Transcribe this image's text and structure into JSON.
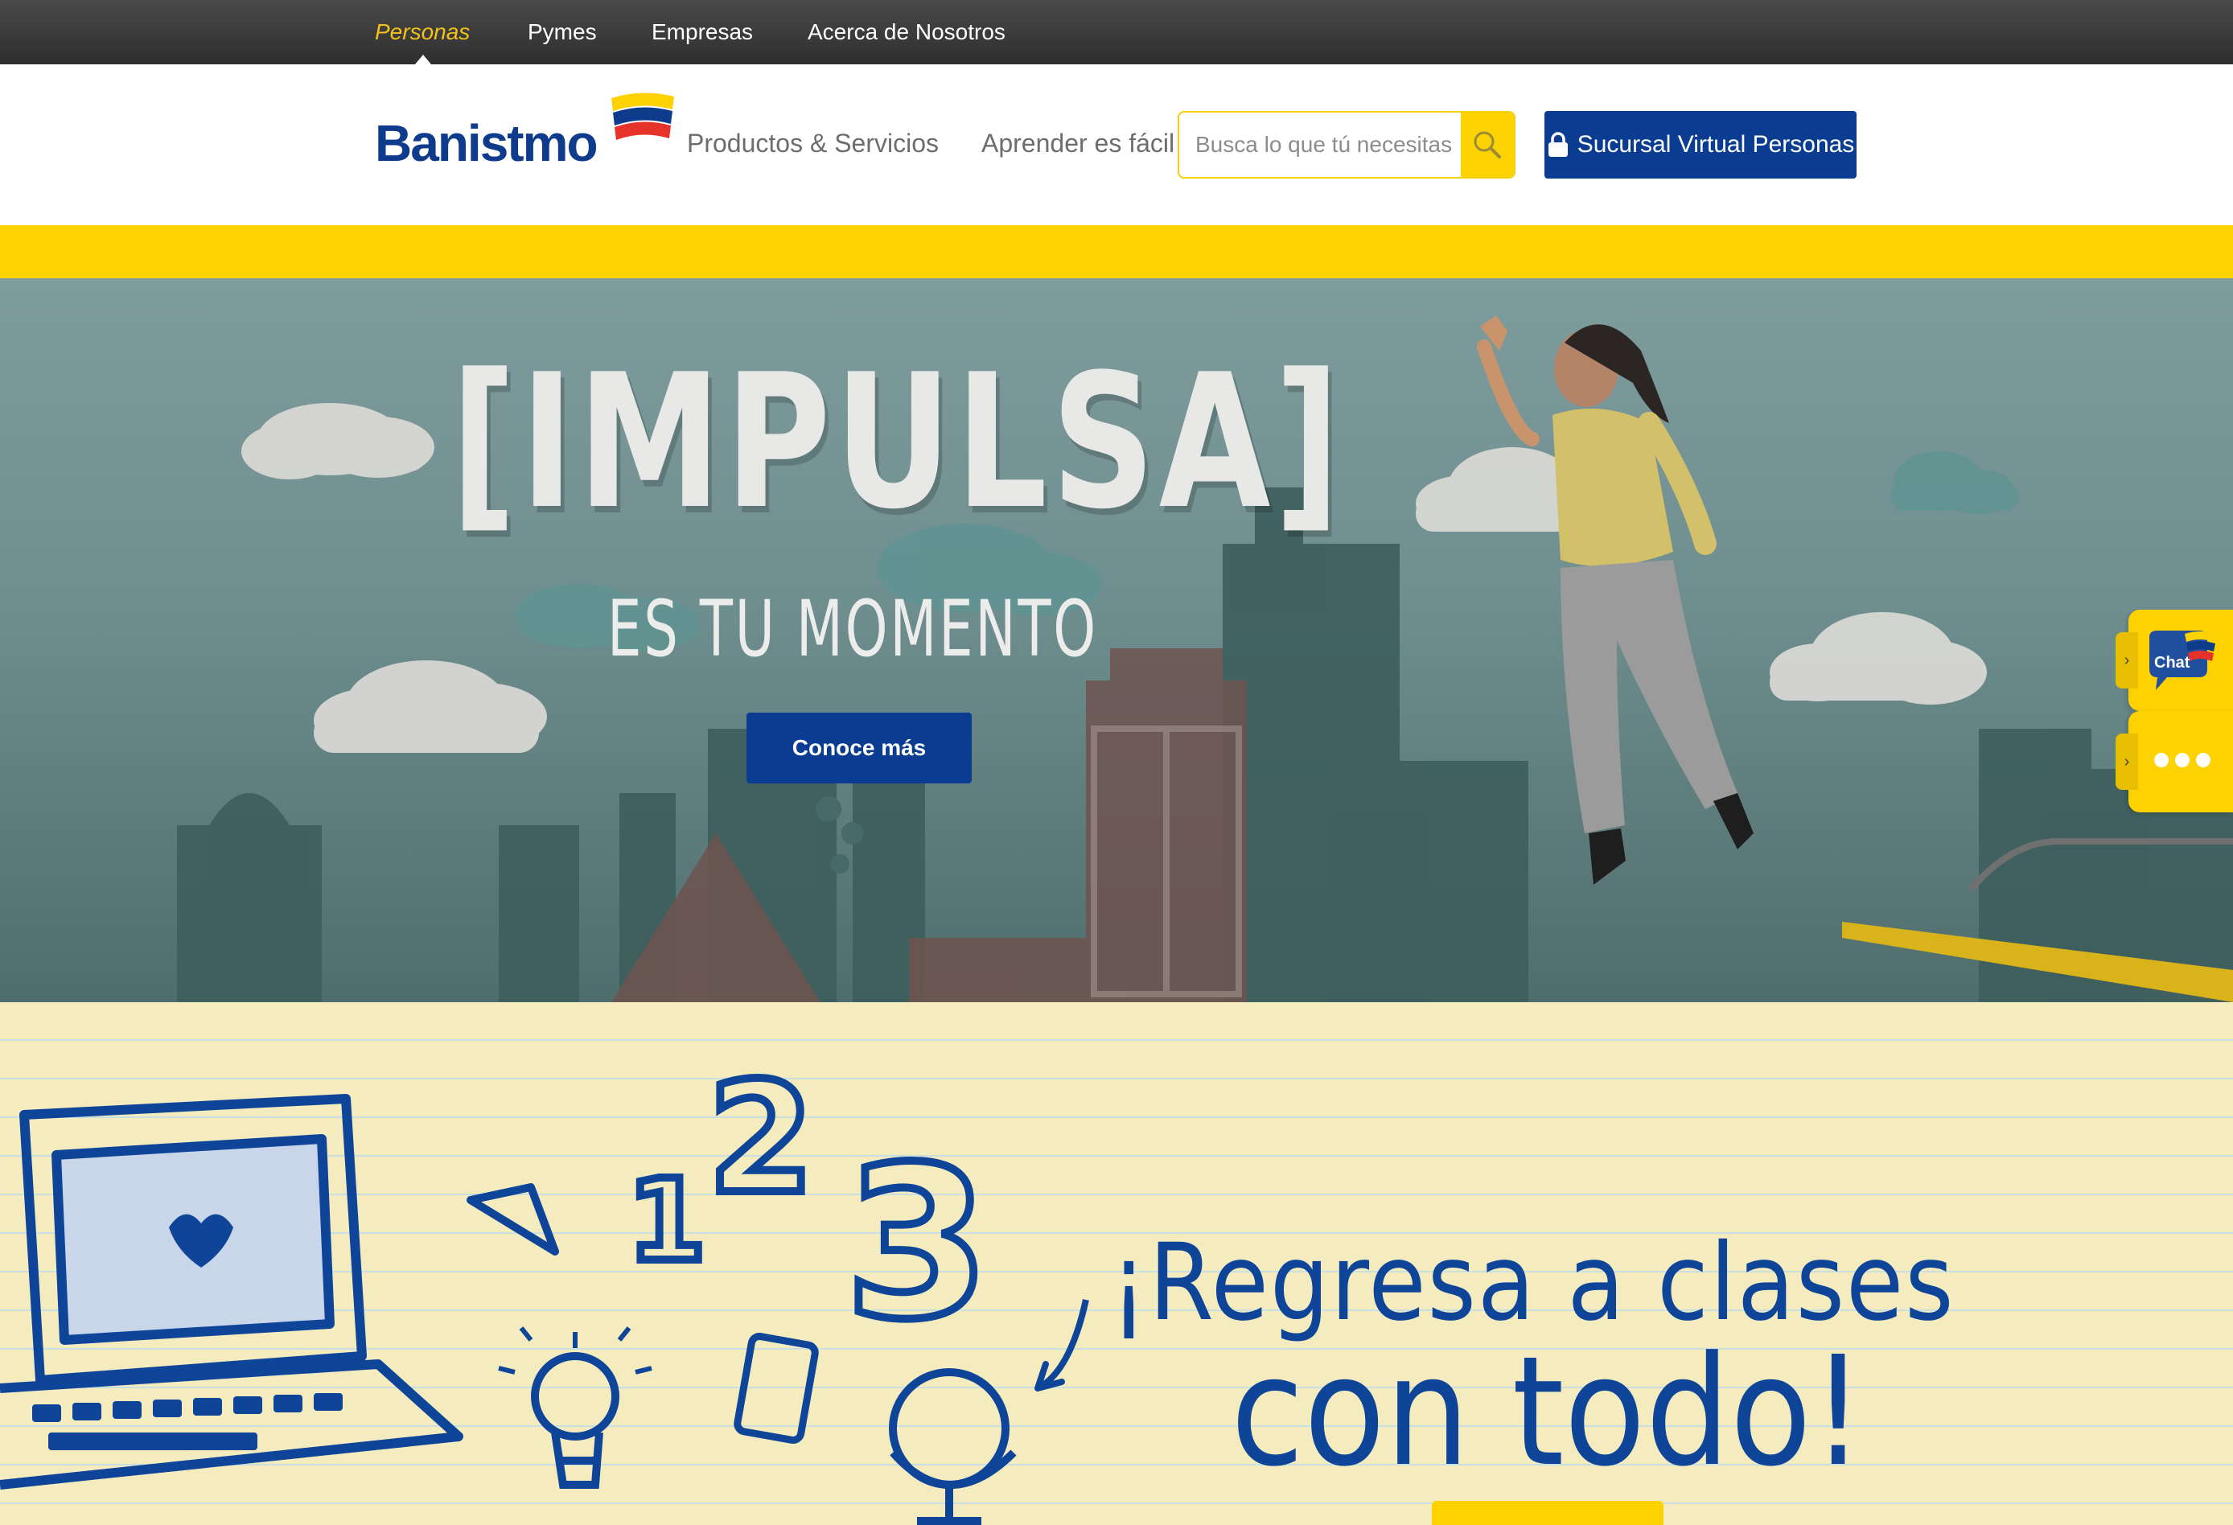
{
  "topnav": {
    "items": [
      {
        "label": "Personas",
        "active": true
      },
      {
        "label": "Pymes",
        "active": false
      },
      {
        "label": "Empresas",
        "active": false
      },
      {
        "label": "Acerca de Nosotros",
        "active": false
      }
    ]
  },
  "header": {
    "logo_text": "Banistmo",
    "nav": [
      {
        "label": "Productos & Servicios"
      },
      {
        "label": "Aprender es fácil"
      }
    ],
    "search": {
      "placeholder": "Busca lo que tú necesitas",
      "icon": "search-icon"
    },
    "virtual_branch_button": {
      "label": "Sucursal Virtual Personas",
      "icon": "lock-icon"
    }
  },
  "hero": {
    "title": "[IMPULSA]",
    "subtitle": "ES TU MOMENTO",
    "cta_label": "Conoce más"
  },
  "banner2": {
    "line1": "¡Regresa a clases",
    "line2": "con todo!",
    "numbers": [
      "1",
      "2",
      "3"
    ]
  },
  "side_widgets": {
    "chat_label": "Chat",
    "more_icon": "more-dots-icon"
  },
  "colors": {
    "brand_blue": "#0a3d91",
    "brand_yellow": "#fed100",
    "active_segment": "#f2c21b",
    "hero_sky": "#7f9c9d",
    "notebook_paper": "#f4ecbf"
  }
}
